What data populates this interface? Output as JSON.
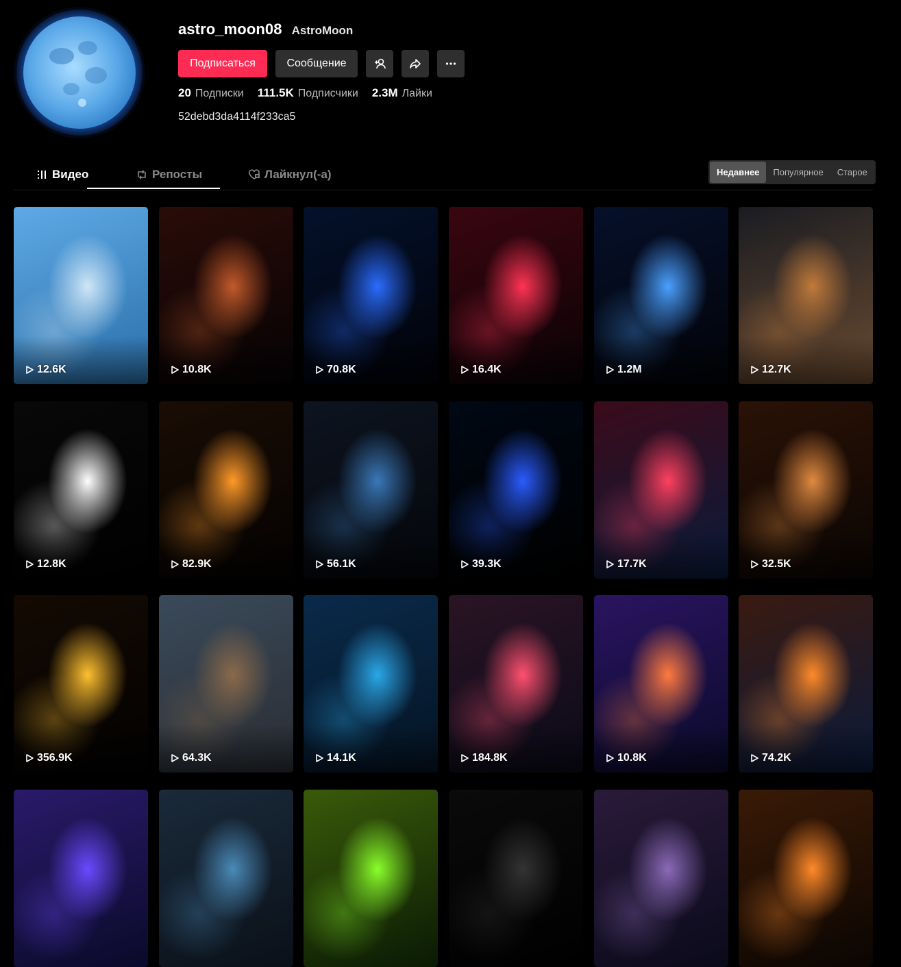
{
  "profile": {
    "username": "astro_moon08",
    "nickname": "AstroMoon",
    "follow_label": "Подписаться",
    "message_label": "Сообщение",
    "bio": "52debd3da4114f233ca5",
    "stats": [
      {
        "value": "20",
        "label": "Подписки"
      },
      {
        "value": "111.5K",
        "label": "Подписчики"
      },
      {
        "value": "2.3M",
        "label": "Лайки"
      }
    ]
  },
  "tabs": [
    {
      "label": "Видео",
      "icon": "grid-icon",
      "active": true
    },
    {
      "label": "Репосты",
      "icon": "repost-icon",
      "active": false
    },
    {
      "label": "Лайкнул(-а)",
      "icon": "heart-lock-icon",
      "active": false
    }
  ],
  "sort": [
    {
      "label": "Недавнее",
      "active": true
    },
    {
      "label": "Популярное",
      "active": false
    },
    {
      "label": "Старое",
      "active": false
    }
  ],
  "videos": [
    {
      "views": "12.6K",
      "colors": [
        "#5ea9e6",
        "#2a6fa8"
      ],
      "accent": "#cfe6f7",
      "subject": "ice-hand"
    },
    {
      "views": "10.8K",
      "colors": [
        "#2a0c08",
        "#050204"
      ],
      "accent": "#c15a2a",
      "subject": "black-hole"
    },
    {
      "views": "70.8K",
      "colors": [
        "#04112b",
        "#010208"
      ],
      "accent": "#2a6cff",
      "subject": "warp-eye"
    },
    {
      "views": "16.4K",
      "colors": [
        "#3a0610",
        "#0a0205"
      ],
      "accent": "#ff3355",
      "subject": "red-swirl"
    },
    {
      "views": "1.2M",
      "colors": [
        "#06102a",
        "#020308"
      ],
      "accent": "#4aa0ff",
      "subject": "star-tunnel"
    },
    {
      "views": "12.7K",
      "colors": [
        "#1a1c22",
        "#6a4a30"
      ],
      "accent": "#c07a3a",
      "subject": "asteroid-rock"
    },
    {
      "views": "12.8K",
      "colors": [
        "#080808",
        "#000000"
      ],
      "accent": "#ffffff",
      "subject": "comet"
    },
    {
      "views": "82.9K",
      "colors": [
        "#1a0d04",
        "#040202"
      ],
      "accent": "#ff9a2a",
      "subject": "fire-ring"
    },
    {
      "views": "56.1K",
      "colors": [
        "#0d1420",
        "#04060a"
      ],
      "accent": "#3a78b8",
      "subject": "planet"
    },
    {
      "views": "39.3K",
      "colors": [
        "#000814",
        "#000000"
      ],
      "accent": "#2a5cff",
      "subject": "blue-beams"
    },
    {
      "views": "17.7K",
      "colors": [
        "#3a0b1a",
        "#0a1a3a"
      ],
      "accent": "#ff4060",
      "subject": "hyperspace"
    },
    {
      "views": "32.5K",
      "colors": [
        "#2a1206",
        "#0a0503"
      ],
      "accent": "#e08a40",
      "subject": "mars-horizon"
    },
    {
      "views": "356.9K",
      "colors": [
        "#140a02",
        "#020101"
      ],
      "accent": "#ffc030",
      "subject": "gold-ring"
    },
    {
      "views": "64.3K",
      "colors": [
        "#3a4a5a",
        "#2a2d33"
      ],
      "accent": "#8a6a4a",
      "subject": "garage"
    },
    {
      "views": "14.1K",
      "colors": [
        "#0a2a4a",
        "#051424"
      ],
      "accent": "#2aa8e8",
      "subject": "ice-cave"
    },
    {
      "views": "184.8K",
      "colors": [
        "#2a1424",
        "#0a0a18"
      ],
      "accent": "#ff5070",
      "subject": "asteroids"
    },
    {
      "views": "10.8K",
      "colors": [
        "#2a1460",
        "#0a0a2a"
      ],
      "accent": "#ff7a40",
      "subject": "galaxy"
    },
    {
      "views": "74.2K",
      "colors": [
        "#3a1a10",
        "#0a1a3a"
      ],
      "accent": "#ff8a2a",
      "subject": "nebula"
    },
    {
      "views": "",
      "colors": [
        "#2a1a6a",
        "#0a0a2a"
      ],
      "accent": "#6a4aff",
      "subject": "purple"
    },
    {
      "views": "",
      "colors": [
        "#1a2a3a",
        "#0a1018"
      ],
      "accent": "#4a8ab8",
      "subject": "teal"
    },
    {
      "views": "",
      "colors": [
        "#3a5a0a",
        "#0a1a04"
      ],
      "accent": "#8aff2a",
      "subject": "green"
    },
    {
      "views": "",
      "colors": [
        "#0a0a0a",
        "#000000"
      ],
      "accent": "#333333",
      "subject": "dark"
    },
    {
      "views": "",
      "colors": [
        "#2a1a3a",
        "#0a0a1a"
      ],
      "accent": "#8a6ab8",
      "subject": "dusk"
    },
    {
      "views": "",
      "colors": [
        "#3a1a06",
        "#0a0502"
      ],
      "accent": "#ff8a2a",
      "subject": "ember"
    }
  ]
}
